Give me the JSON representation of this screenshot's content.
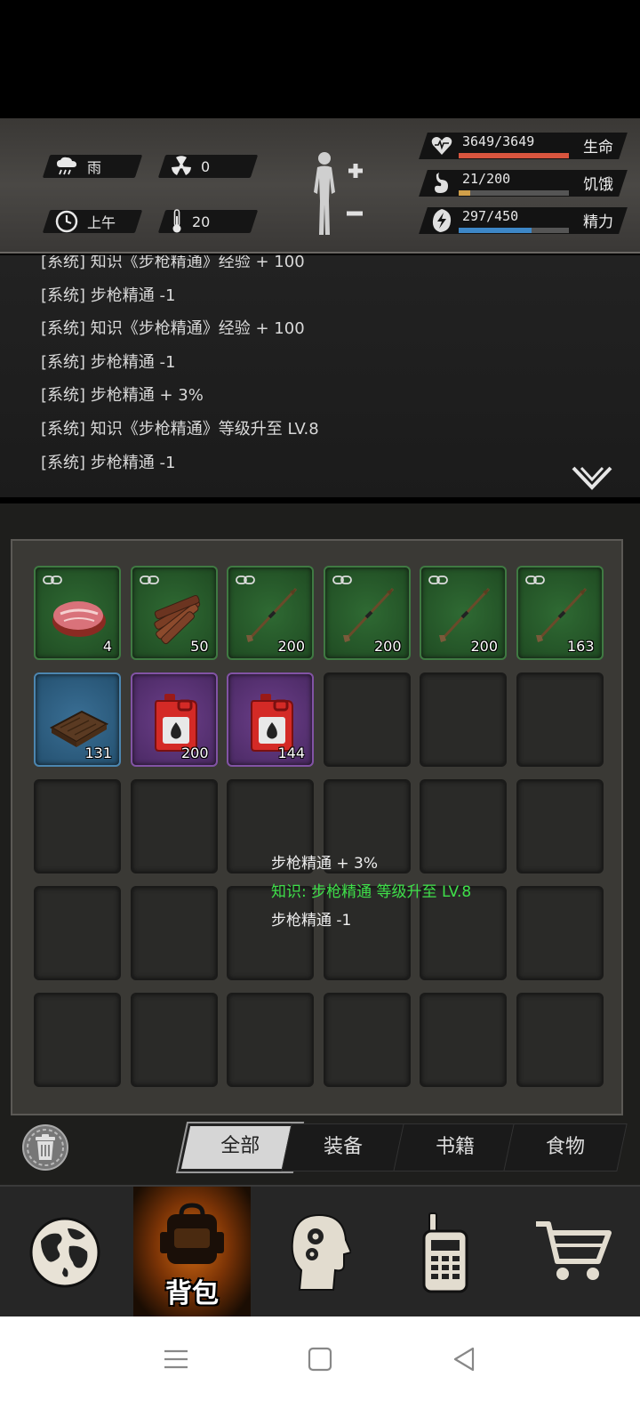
{
  "status": {
    "weather": "雨",
    "radiation": "0",
    "time_of_day": "上午",
    "temperature": "20",
    "stats": [
      {
        "key": "health",
        "value_text": "3649/3649",
        "label": "生命",
        "fraction": 1.0,
        "color": "#d9553e",
        "icon": "heart-icon"
      },
      {
        "key": "hunger",
        "value_text": "21/200",
        "label": "饥饿",
        "fraction": 0.105,
        "color": "#d1a04a",
        "icon": "stomach-icon"
      },
      {
        "key": "energy",
        "value_text": "297/450",
        "label": "精力",
        "fraction": 0.66,
        "color": "#3d87c7",
        "icon": "lightning-icon"
      }
    ]
  },
  "log": {
    "lines": [
      "[系统] 知识《步枪精通》经验 + 100",
      "[系统] 步枪精通 -1",
      "[系统] 知识《步枪精通》经验 + 100",
      "[系统] 步枪精通 -1",
      "[系统] 步枪精通 + 3%",
      "[系统] 知识《步枪精通》等级升至 LV.8",
      "[系统] 步枪精通 -1"
    ]
  },
  "inventory": {
    "items": [
      {
        "art": "meat-icon",
        "rarity": "green",
        "qty": "4",
        "bound": true
      },
      {
        "art": "wood-sticks-icon",
        "rarity": "green",
        "qty": "50",
        "bound": true
      },
      {
        "art": "arrow-icon",
        "rarity": "green",
        "qty": "200",
        "bound": true
      },
      {
        "art": "arrow-icon",
        "rarity": "green",
        "qty": "200",
        "bound": true
      },
      {
        "art": "arrow-icon",
        "rarity": "green",
        "qty": "200",
        "bound": true
      },
      {
        "art": "arrow-icon",
        "rarity": "green",
        "qty": "163",
        "bound": true
      },
      {
        "art": "wood-board-icon",
        "rarity": "blue",
        "qty": "131",
        "bound": false
      },
      {
        "art": "fuel-can-icon",
        "rarity": "purple",
        "qty": "200",
        "bound": false
      },
      {
        "art": "fuel-can-icon",
        "rarity": "purple",
        "qty": "144",
        "bound": false
      }
    ],
    "total_slots": 30
  },
  "toast": {
    "lines": [
      {
        "text": "步枪精通 + 3%",
        "color": "white"
      },
      {
        "text": "知识: 步枪精通 等级升至 LV.8",
        "color": "green"
      },
      {
        "text": "步枪精通 -1",
        "color": "white"
      }
    ]
  },
  "categories": {
    "tabs": [
      "全部",
      "装备",
      "书籍",
      "食物"
    ],
    "active_index": 0
  },
  "nav": {
    "items": [
      "globe-icon",
      "backpack-icon",
      "brain-head-icon",
      "walkie-talkie-icon",
      "cart-icon"
    ],
    "active_label": "背包"
  }
}
